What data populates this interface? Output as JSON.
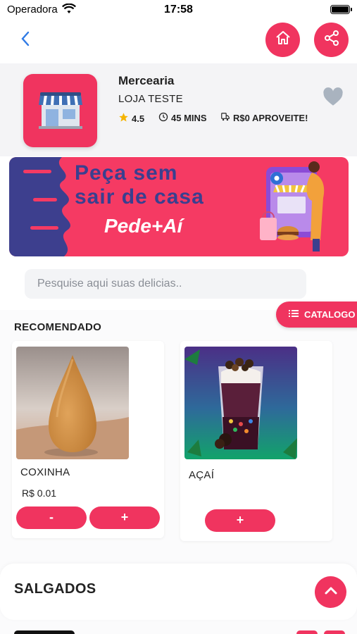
{
  "status_bar": {
    "carrier": "Operadora",
    "time": "17:58"
  },
  "nav": {
    "back_icon": "chevron-left-icon",
    "home_icon": "home-icon",
    "share_icon": "share-icon"
  },
  "store": {
    "name": "Mercearia",
    "subtitle": "LOJA TESTE",
    "rating": "4.5",
    "delivery_time": "45 MINS",
    "delivery_fee": "R$0 APROVEITE!"
  },
  "banner": {
    "line1": "Peça sem",
    "line2": "sair de casa",
    "brand": "Pede+Aí"
  },
  "search": {
    "placeholder": "Pesquise aqui suas delicias.."
  },
  "catalog_button": {
    "label": "CATALOGO"
  },
  "recommended": {
    "title": "RECOMENDADO",
    "products": [
      {
        "name": "COXINHA",
        "price": "R$ 0.01",
        "minus": "-",
        "plus": "+"
      },
      {
        "name": "AÇAÍ",
        "plus": "+"
      }
    ]
  },
  "section": {
    "title": "SALGADOS"
  },
  "colors": {
    "accent": "#f0345f",
    "banner_text": "#3a3f8f",
    "link_blue": "#2f7ae5"
  }
}
